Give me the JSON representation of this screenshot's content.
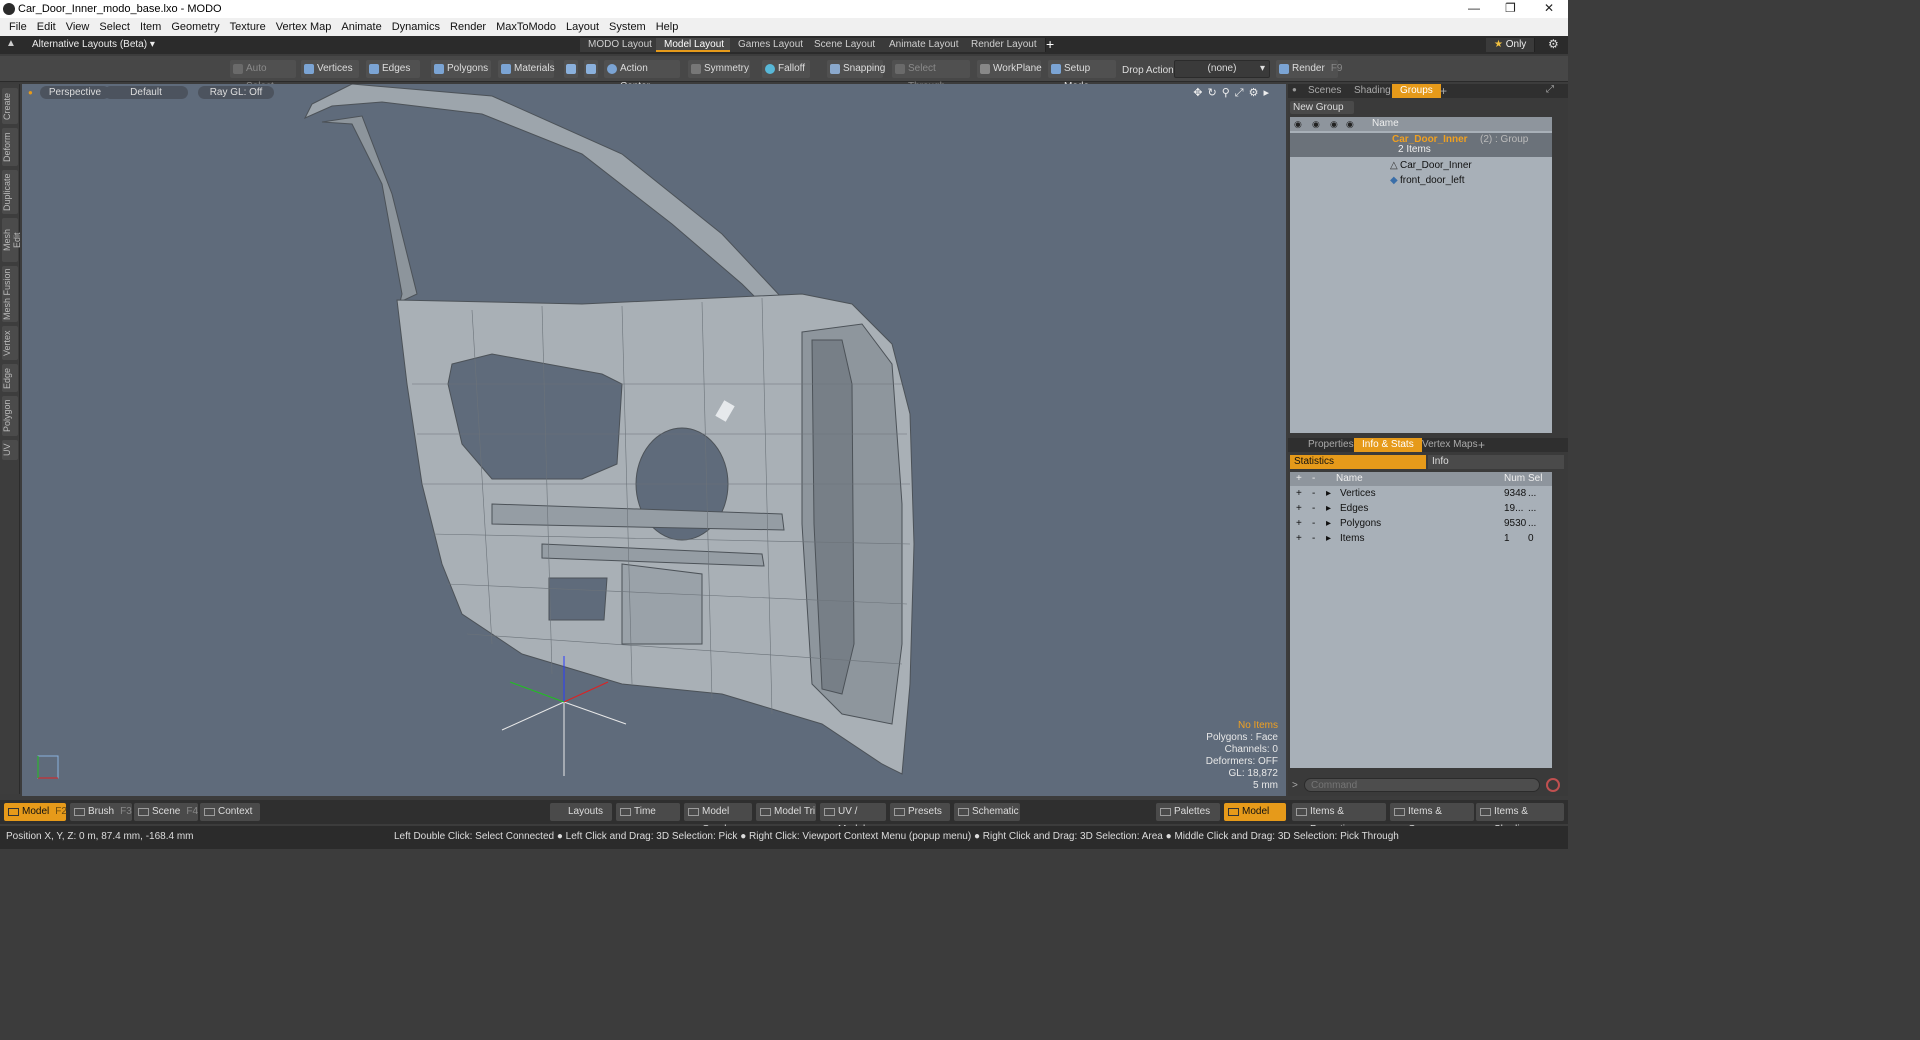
{
  "window": {
    "title": "Car_Door_Inner_modo_base.lxo - MODO"
  },
  "menu": [
    "File",
    "Edit",
    "View",
    "Select",
    "Item",
    "Geometry",
    "Texture",
    "Vertex Map",
    "Animate",
    "Dynamics",
    "Render",
    "MaxToModo",
    "Layout",
    "System",
    "Help"
  ],
  "layout_selector": "Alternative Layouts (Beta)",
  "layout_tabs": [
    "MODO Layout",
    "Model Layout",
    "Games Layout",
    "Scene Layout",
    "Animate Layout",
    "Render Layout"
  ],
  "active_layout": "Model Layout",
  "only_label": "Only",
  "toolbar": {
    "auto_select": "Auto Select",
    "vertices": "Vertices",
    "edges": "Edges",
    "polygons": "Polygons",
    "materials": "Materials",
    "action_center": "Action Center",
    "symmetry": "Symmetry",
    "falloff": "Falloff",
    "snapping": "Snapping",
    "select_through": "Select Through",
    "workplane": "WorkPlane",
    "setup_mode": "Setup Mode",
    "drop_action": "Drop Action",
    "drop_value": "(none)",
    "render": "Render",
    "render_key": "F9"
  },
  "left_tabs": [
    "Create",
    "Deform",
    "Duplicate",
    "Mesh Edit",
    "Mesh Fusion",
    "Vertex",
    "Edge",
    "Polygon",
    "UV"
  ],
  "viewport": {
    "projection": "Perspective",
    "style": "Default",
    "raygl": "Ray GL: Off",
    "info": {
      "items": "No Items",
      "polygons": "Polygons : Face",
      "channels": "Channels: 0",
      "deformers": "Deformers: OFF",
      "gl": "GL: 18,872",
      "scale": "5 mm"
    }
  },
  "groups_panel": {
    "tabs": [
      "Scenes",
      "Shading",
      "Groups"
    ],
    "active_tab": "Groups",
    "new_group": "New Group",
    "col_name": "Name",
    "group_name": "Car_Door_Inner",
    "group_suffix": "(2) : Group",
    "group_count": "2 Items",
    "children": [
      "Car_Door_Inner",
      "front_door_left"
    ]
  },
  "info_panel": {
    "tabs": [
      "Properties",
      "Info & Stats",
      "Vertex Maps"
    ],
    "active_tab": "Info & Stats",
    "subtabs": [
      "Statistics",
      "Info"
    ],
    "columns": [
      "Name",
      "Num",
      "Sel"
    ],
    "rows": [
      {
        "name": "Vertices",
        "num": "9348",
        "sel": "..."
      },
      {
        "name": "Edges",
        "num": "19...",
        "sel": "..."
      },
      {
        "name": "Polygons",
        "num": "9530",
        "sel": "..."
      },
      {
        "name": "Items",
        "num": "1",
        "sel": "0"
      }
    ],
    "command_placeholder": "Command"
  },
  "bottom_left": [
    {
      "label": "Model",
      "key": "F2",
      "active": true
    },
    {
      "label": "Brush",
      "key": "F3",
      "active": false
    },
    {
      "label": "Scene",
      "key": "F4",
      "active": false
    },
    {
      "label": "Context",
      "key": "",
      "active": false
    }
  ],
  "bottom_center": [
    "Layouts",
    "Time",
    "Model Quad",
    "Model Tri",
    "UV / Model",
    "Presets",
    "Schematic"
  ],
  "bottom_right": [
    "Palettes",
    "Model",
    "Items & Properties",
    "Items & Groups",
    "Items & Shading"
  ],
  "status": {
    "position": "Position X, Y, Z:   0 m, 87.4 mm, -168.4 mm",
    "hints": "Left Double Click: Select Connected ● Left Click and Drag: 3D Selection: Pick ● Right Click: Viewport Context Menu (popup menu) ● Right Click and Drag: 3D Selection: Area ● Middle Click and Drag: 3D Selection: Pick Through"
  },
  "colors": {
    "accent": "#e69a1a",
    "viewport_bg": "#5f6b7b",
    "mesh": "#a9b0b6"
  }
}
